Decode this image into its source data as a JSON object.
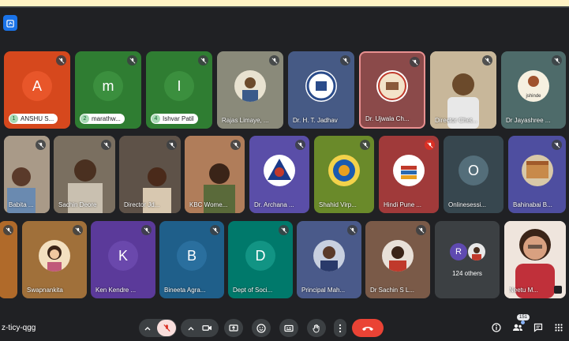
{
  "meeting": {
    "code": "z-ticy-qgg",
    "participant_count": "151"
  },
  "tiles": [
    {
      "name": "ANSHU S...",
      "initial": "A",
      "num": "1",
      "bg": "#c9471c",
      "avatar": "#e8562a"
    },
    {
      "name": "marathw...",
      "initial": "m",
      "num": "2",
      "bg": "#2e7d32",
      "avatar": "#388e3c"
    },
    {
      "name": "Ishvar Patil",
      "initial": "I",
      "num": "4",
      "bg": "#2e7d32",
      "avatar": "#388e3c"
    },
    {
      "name": "Rajas Limaye, ..."
    },
    {
      "name": "Dr. H. T. Jadhav"
    },
    {
      "name": "Dr. Ujwala Ch..."
    },
    {
      "name": "Director Chet..."
    },
    {
      "name": "Dr Jayashree ...",
      "pic_label": "jshinde"
    },
    {
      "name": "Babita ..."
    },
    {
      "name": "Sachin Deore"
    },
    {
      "name": "Director Jd..."
    },
    {
      "name": "KBC Wome..."
    },
    {
      "name": "Dr. Archana ..."
    },
    {
      "name": "Shahid Virp..."
    },
    {
      "name": "Hindi Pune ..."
    },
    {
      "name": "Onlinesessi...",
      "initial": "O"
    },
    {
      "name": "Bahinabai B..."
    },
    {
      "name": "Swapnankita"
    },
    {
      "name": "Ken Kendre ...",
      "initial": "K"
    },
    {
      "name": "Bineeta Agra...",
      "initial": "B"
    },
    {
      "name": "Dept of Soci...",
      "initial": "D"
    },
    {
      "name": "Principal Mah..."
    },
    {
      "name": "Dr Sachin S L..."
    },
    {
      "name": "124 others",
      "initial": "R"
    },
    {
      "name": "Neetu M..."
    }
  ]
}
